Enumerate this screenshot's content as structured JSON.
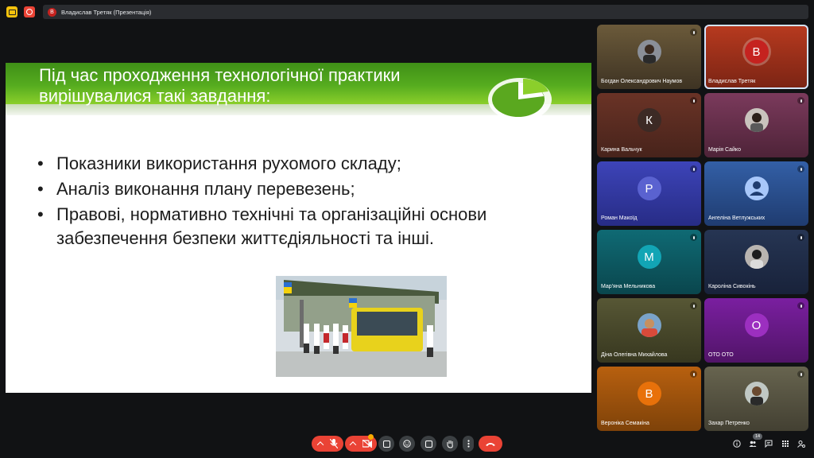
{
  "topbar": {
    "presenter_initial": "В",
    "presentation_label": "Владислав Третяк (Презентація)"
  },
  "slide": {
    "title": "Під час  проходження технологічної практики\nвирішувалися такі завдання:",
    "bullets": [
      "Показники використання рухомого складу;",
      "Аналіз виконання плану перевезень;",
      "Правові, нормативно технічні та організаційні основи забезпечення безпеки життєдіяльності та інші."
    ]
  },
  "participants": [
    {
      "name": "Богдан Олександрович Наумов",
      "avatar": "photo",
      "bg": "#5b4a30"
    },
    {
      "name": "Владислав Третяк",
      "avatar": "letter",
      "initial": "В",
      "circle": "#c5221f",
      "bg": "#a1321c"
    },
    {
      "name": "Карина Вальчук",
      "avatar": "letter",
      "initial": "К",
      "circle": "#3c2a25",
      "bg": "#5a2e24"
    },
    {
      "name": "Марія Сайко",
      "avatar": "photo",
      "bg": "#6e3452"
    },
    {
      "name": "Роман Макоїд",
      "avatar": "letter",
      "initial": "Р",
      "circle": "#4f56c4",
      "bg": "#2f35a0"
    },
    {
      "name": "Ангеліна Ветлужських",
      "avatar": "person",
      "circle": "#a8c7fa",
      "bg": "#2d4e8f"
    },
    {
      "name": "Мар'яна Мельникова",
      "avatar": "letter",
      "initial": "М",
      "circle": "#12a5b5",
      "bg": "#0e5d66"
    },
    {
      "name": "Кароліна Сивокінь",
      "avatar": "photo",
      "bg": "#23304a"
    },
    {
      "name": "Діна Олегівна Михайлова",
      "avatar": "photo",
      "bg": "#4a4a2a"
    },
    {
      "name": "ОТО ОТО",
      "avatar": "letter",
      "initial": "О",
      "circle": "#8e24aa",
      "bg": "#6a1b8a"
    },
    {
      "name": "Вероніка Семакіна",
      "avatar": "letter",
      "initial": "В",
      "circle": "#e8710a",
      "bg": "#a8510d"
    },
    {
      "name": "Захар Петренко",
      "avatar": "photo",
      "bg": "#5a5848"
    }
  ],
  "bottombar": {
    "people_count": "14"
  }
}
